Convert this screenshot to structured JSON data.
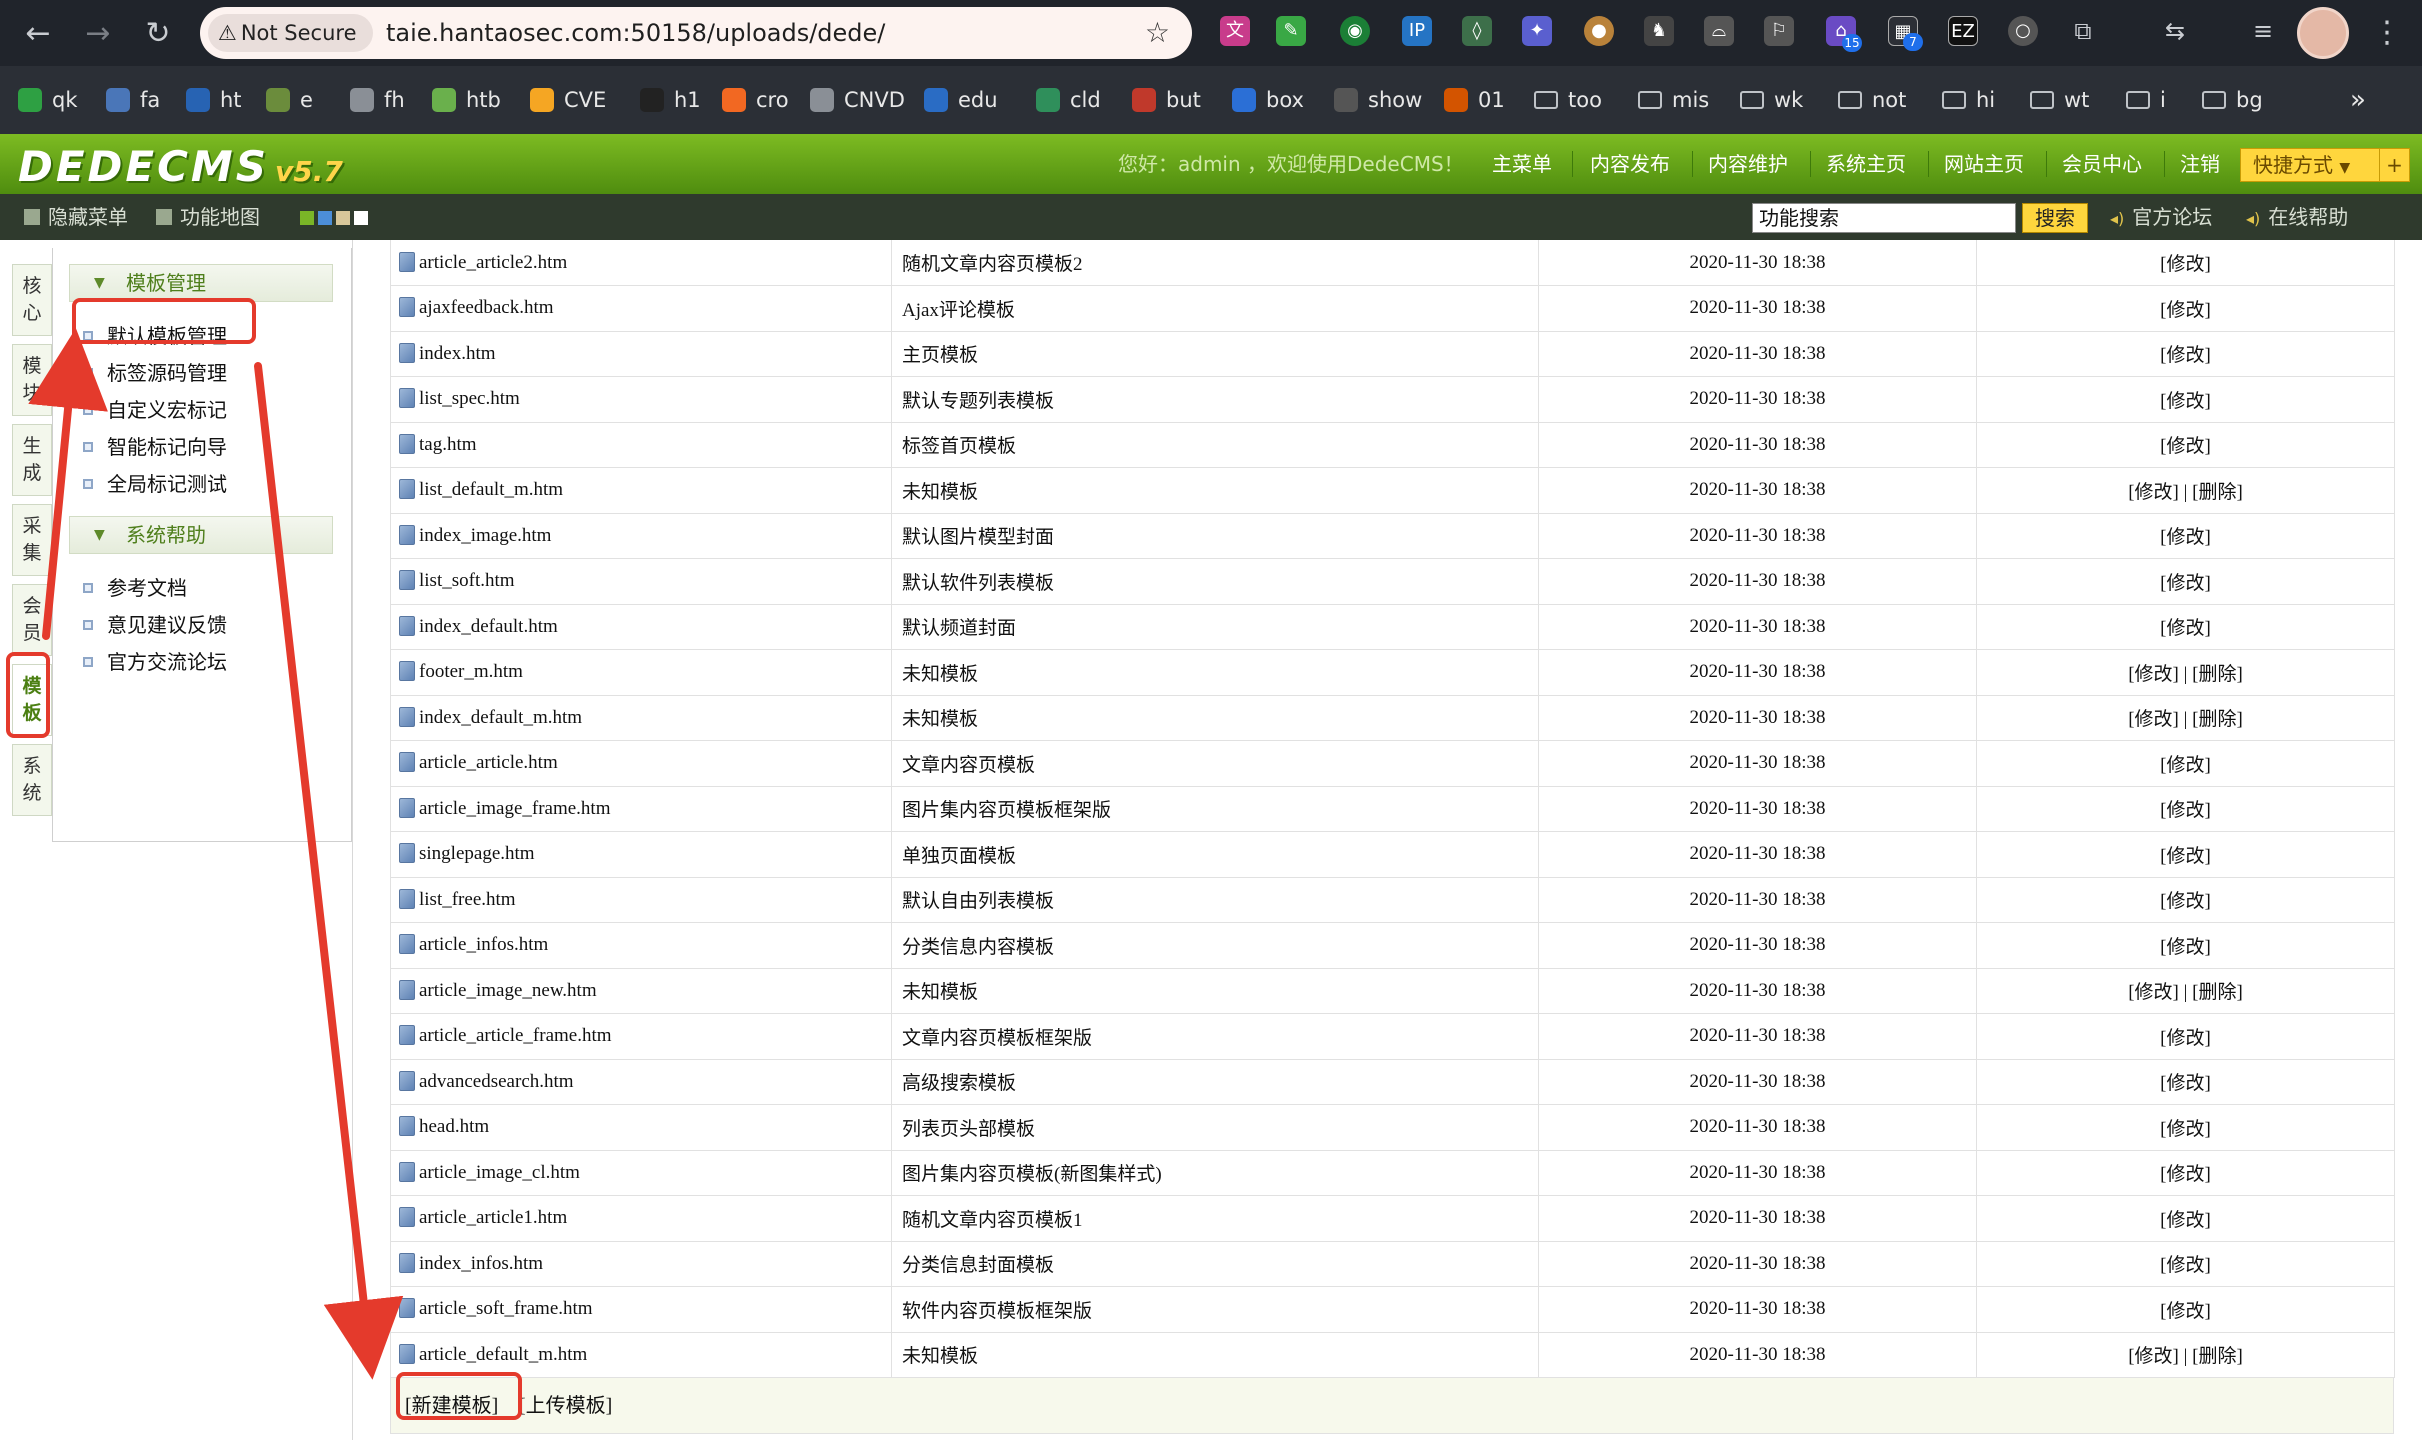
{
  "browser": {
    "security_label": "Not Secure",
    "url": "taie.hantaosec.com:50158/uploads/dede/",
    "badges": {
      "ext1": "15",
      "ext2": "7"
    },
    "bookmarks": [
      {
        "label": "qk",
        "icon": "green-plus-icon"
      },
      {
        "label": "fa",
        "icon": "fa-icon"
      },
      {
        "label": "ht",
        "icon": "game-icon"
      },
      {
        "label": "e",
        "icon": "map-icon"
      },
      {
        "label": "fh",
        "icon": "shield-icon"
      },
      {
        "label": "htb",
        "icon": "cube-icon"
      },
      {
        "label": "CVE",
        "icon": "orange-square-icon"
      },
      {
        "label": "h1",
        "icon": "h1-icon"
      },
      {
        "label": "cro",
        "icon": "bugcrowd-icon"
      },
      {
        "label": "CNVD",
        "icon": "cnvd-icon"
      },
      {
        "label": "edu",
        "icon": "edu-icon"
      },
      {
        "label": "cld",
        "icon": "cloud-icon"
      },
      {
        "label": "but",
        "icon": "star-badge-icon"
      },
      {
        "label": "box",
        "icon": "hexagon-icon"
      },
      {
        "label": "show",
        "icon": "runner-icon"
      },
      {
        "label": "01",
        "icon": "bookmark-01-icon"
      },
      {
        "label": "too",
        "icon": "folder-icon"
      },
      {
        "label": "mis",
        "icon": "folder-icon"
      },
      {
        "label": "wk",
        "icon": "folder-icon"
      },
      {
        "label": "not",
        "icon": "folder-icon"
      },
      {
        "label": "hi",
        "icon": "folder-icon"
      },
      {
        "label": "wt",
        "icon": "folder-icon"
      },
      {
        "label": "i",
        "icon": "folder-icon"
      },
      {
        "label": "bg",
        "icon": "folder-icon"
      }
    ]
  },
  "header": {
    "logo": "DEDECMS",
    "logo_version": "v5.7",
    "welcome": "您好：admin ，欢迎使用DedeCMS！",
    "menu": [
      "主菜单",
      "内容发布",
      "内容维护",
      "系统主页",
      "网站主页",
      "会员中心",
      "注销"
    ],
    "quick": "快捷方式",
    "quick_plus": "+"
  },
  "toolbar": {
    "hide_menu": "隐藏菜单",
    "func_map": "功能地图",
    "search_value": "功能搜索",
    "search_btn": "搜索",
    "forum": "官方论坛",
    "help": "在线帮助"
  },
  "sidebar": {
    "vtabs": [
      "核心",
      "模块",
      "生成",
      "采集",
      "会员",
      "模板",
      "系统"
    ],
    "active_tab": "模板",
    "sections": [
      {
        "title": "模板管理",
        "items": [
          "默认模板管理",
          "标签源码管理",
          "自定义宏标记",
          "智能标记向导",
          "全局标记测试"
        ]
      },
      {
        "title": "系统帮助",
        "items": [
          "参考文档",
          "意见建议反馈",
          "官方交流论坛"
        ]
      }
    ]
  },
  "table": {
    "rows": [
      {
        "file": "article_article2.htm",
        "desc": "随机文章内容页模板2",
        "time": "2020-11-30 18:38",
        "action": "[修改]"
      },
      {
        "file": "ajaxfeedback.htm",
        "desc": "Ajax评论模板",
        "time": "2020-11-30 18:38",
        "action": "[修改]"
      },
      {
        "file": "index.htm",
        "desc": "主页模板",
        "time": "2020-11-30 18:38",
        "action": "[修改]"
      },
      {
        "file": "list_spec.htm",
        "desc": "默认专题列表模板",
        "time": "2020-11-30 18:38",
        "action": "[修改]"
      },
      {
        "file": "tag.htm",
        "desc": "标签首页模板",
        "time": "2020-11-30 18:38",
        "action": "[修改]"
      },
      {
        "file": "list_default_m.htm",
        "desc": "未知模板",
        "time": "2020-11-30 18:38",
        "action": "[修改] | [删除]"
      },
      {
        "file": "index_image.htm",
        "desc": "默认图片模型封面",
        "time": "2020-11-30 18:38",
        "action": "[修改]"
      },
      {
        "file": "list_soft.htm",
        "desc": "默认软件列表模板",
        "time": "2020-11-30 18:38",
        "action": "[修改]"
      },
      {
        "file": "index_default.htm",
        "desc": "默认频道封面",
        "time": "2020-11-30 18:38",
        "action": "[修改]"
      },
      {
        "file": "footer_m.htm",
        "desc": "未知模板",
        "time": "2020-11-30 18:38",
        "action": "[修改] | [删除]"
      },
      {
        "file": "index_default_m.htm",
        "desc": "未知模板",
        "time": "2020-11-30 18:38",
        "action": "[修改] | [删除]"
      },
      {
        "file": "article_article.htm",
        "desc": "文章内容页模板",
        "time": "2020-11-30 18:38",
        "action": "[修改]"
      },
      {
        "file": "article_image_frame.htm",
        "desc": "图片集内容页模板框架版",
        "time": "2020-11-30 18:38",
        "action": "[修改]"
      },
      {
        "file": "singlepage.htm",
        "desc": "单独页面模板",
        "time": "2020-11-30 18:38",
        "action": "[修改]"
      },
      {
        "file": "list_free.htm",
        "desc": "默认自由列表模板",
        "time": "2020-11-30 18:38",
        "action": "[修改]"
      },
      {
        "file": "article_infos.htm",
        "desc": "分类信息内容模板",
        "time": "2020-11-30 18:38",
        "action": "[修改]"
      },
      {
        "file": "article_image_new.htm",
        "desc": "未知模板",
        "time": "2020-11-30 18:38",
        "action": "[修改] | [删除]"
      },
      {
        "file": "article_article_frame.htm",
        "desc": "文章内容页模板框架版",
        "time": "2020-11-30 18:38",
        "action": "[修改]"
      },
      {
        "file": "advancedsearch.htm",
        "desc": "高级搜索模板",
        "time": "2020-11-30 18:38",
        "action": "[修改]"
      },
      {
        "file": "head.htm",
        "desc": "列表页头部模板",
        "time": "2020-11-30 18:38",
        "action": "[修改]"
      },
      {
        "file": "article_image_cl.htm",
        "desc": "图片集内容页模板(新图集样式)",
        "time": "2020-11-30 18:38",
        "action": "[修改]"
      },
      {
        "file": "article_article1.htm",
        "desc": "随机文章内容页模板1",
        "time": "2020-11-30 18:38",
        "action": "[修改]"
      },
      {
        "file": "index_infos.htm",
        "desc": "分类信息封面模板",
        "time": "2020-11-30 18:38",
        "action": "[修改]"
      },
      {
        "file": "article_soft_frame.htm",
        "desc": "软件内容页模板框架版",
        "time": "2020-11-30 18:38",
        "action": "[修改]"
      },
      {
        "file": "article_default_m.htm",
        "desc": "未知模板",
        "time": "2020-11-30 18:38",
        "action": "[修改] | [删除]"
      }
    ],
    "footer": {
      "new_template": "[新建模板]",
      "upload_template": "[上传模板]"
    }
  },
  "colors": {
    "brand_green": "#5a9a14",
    "annotation_red": "#e43a2c",
    "quick_yellow": "#ffd63d"
  }
}
